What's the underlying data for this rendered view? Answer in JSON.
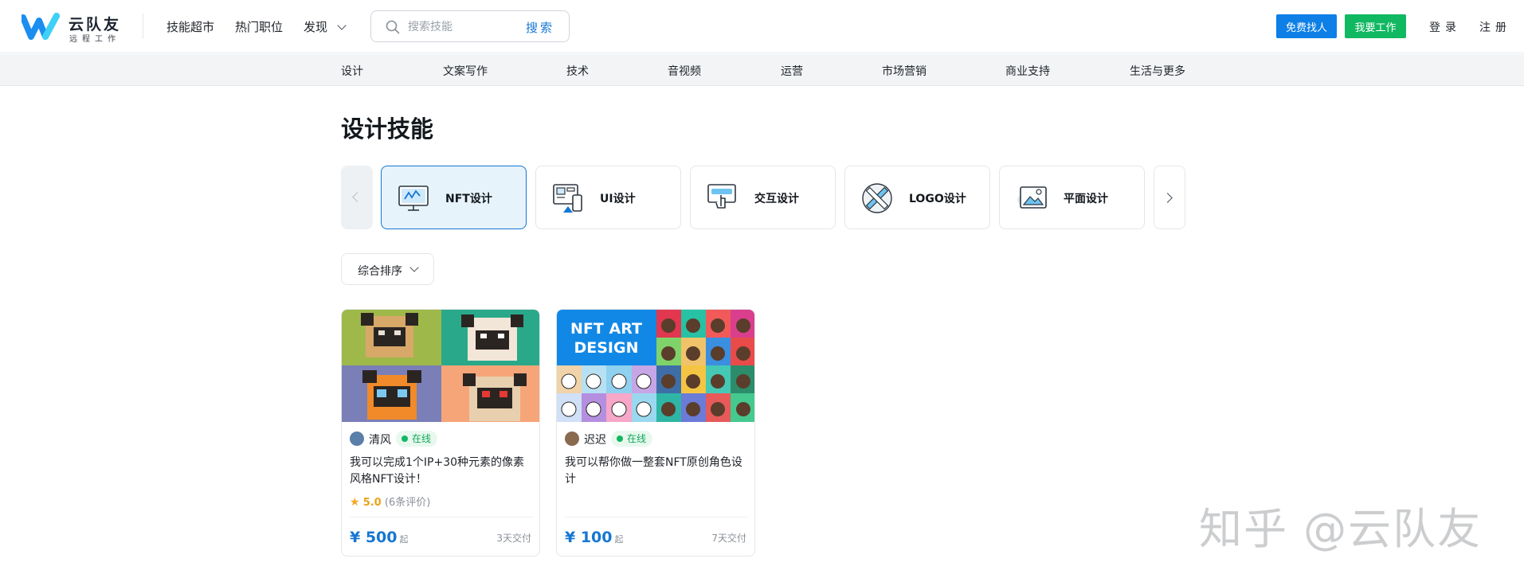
{
  "header": {
    "logo_name": "云队友",
    "logo_sub": "远程工作",
    "nav": [
      "技能超市",
      "热门职位"
    ],
    "discover_label": "发现",
    "search": {
      "placeholder": "搜索技能",
      "button": "搜索"
    },
    "btn_hire": "免费找人",
    "btn_work": "我要工作",
    "login": "登录",
    "register": "注册"
  },
  "categories": [
    "设计",
    "文案写作",
    "技术",
    "音视频",
    "运营",
    "市场营销",
    "商业支持",
    "生活与更多"
  ],
  "main": {
    "title": "设计技能",
    "skills": [
      {
        "label": "NFT设计",
        "icon": "nft-monitor-icon",
        "active": true
      },
      {
        "label": "UI设计",
        "icon": "ui-layout-icon",
        "active": false
      },
      {
        "label": "交互设计",
        "icon": "touch-screen-icon",
        "active": false
      },
      {
        "label": "LOGO设计",
        "icon": "pen-ruler-icon",
        "active": false
      },
      {
        "label": "平面设计",
        "icon": "image-frame-icon",
        "active": false
      }
    ],
    "sort_label": "综合排序"
  },
  "gigs": [
    {
      "seller": "清风",
      "status": "在线",
      "title": "我可以完成1个IP+30种元素的像素风格NFT设计！",
      "rating": "5.0",
      "reviews": "(6条评价)",
      "price": "¥ 500",
      "price_suffix": "起",
      "delivery": "3天交付"
    },
    {
      "seller": "迟迟",
      "status": "在线",
      "title": "我可以帮你做一整套NFT原创角色设计",
      "price": "¥ 100",
      "price_suffix": "起",
      "delivery": "7天交付",
      "banner_text": [
        "NFT ART",
        "DESIGN"
      ]
    }
  ],
  "watermark": "知乎 @云队友",
  "colors": {
    "brand_blue": "#1677d2",
    "hire_button": "#0d7fe6",
    "work_button": "#11b862",
    "price": "#1677d2"
  }
}
